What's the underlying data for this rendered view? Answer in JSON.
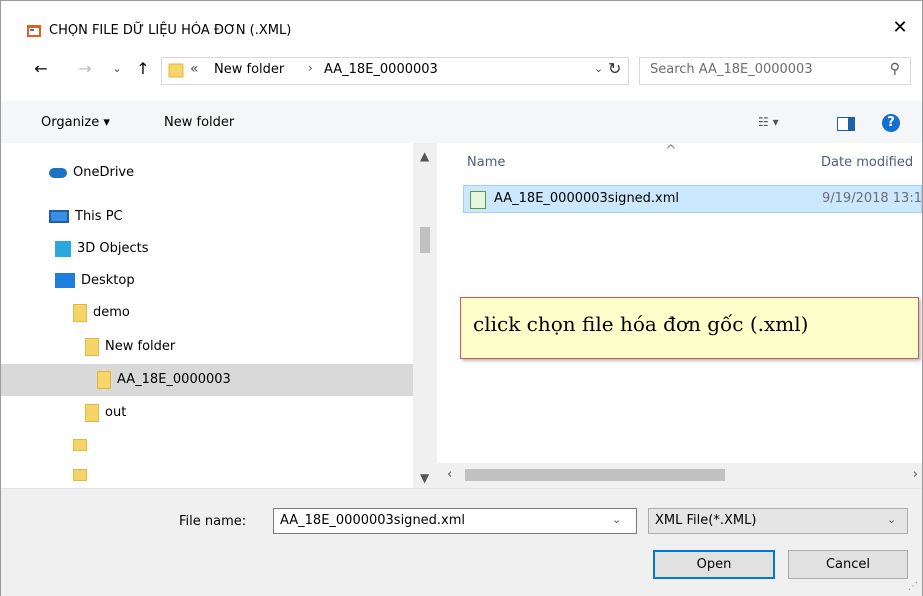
{
  "window": {
    "title": "CHỌN FILE DỮ LIỆU HÓA ĐƠN (.XML)",
    "close_label": "✕"
  },
  "address": {
    "overflow": "«",
    "crumbs": [
      "New folder",
      "AA_18E_0000003"
    ],
    "separator": "›",
    "search_placeholder": "Search AA_18E_0000003"
  },
  "toolbar": {
    "organize_label": "Organize ▾",
    "new_folder_label": "New folder",
    "view_label": "☷ ▾",
    "help_label": "?"
  },
  "tree": {
    "items": [
      {
        "label": "OneDrive",
        "icon": "cloud-icon"
      },
      {
        "label": "This PC",
        "icon": "pc-icon"
      },
      {
        "label": "3D Objects",
        "icon": "cube-icon"
      },
      {
        "label": "Desktop",
        "icon": "desktop-icon"
      },
      {
        "label": "demo",
        "icon": "folder-icon"
      },
      {
        "label": "New folder",
        "icon": "folder-icon"
      },
      {
        "label": "AA_18E_0000003",
        "icon": "folder-icon",
        "selected": true
      },
      {
        "label": "out",
        "icon": "folder-icon"
      }
    ]
  },
  "list": {
    "columns": {
      "name": "Name",
      "date": "Date modified"
    },
    "files": [
      {
        "name": "AA_18E_0000003signed.xml",
        "date": "9/19/2018 13:1"
      }
    ]
  },
  "callout": {
    "text": "click chọn file hóa đơn gốc (.xml)"
  },
  "bottom": {
    "filename_label": "File name:",
    "filename_value": "AA_18E_0000003signed.xml",
    "filetype_value": "XML File(*.XML)",
    "open_label": "Open",
    "cancel_label": "Cancel"
  },
  "colors": {
    "selection": "#cce8ff",
    "callout_bg": "#ffffcc",
    "callout_border": "#d85858",
    "accent": "#0078d7"
  }
}
